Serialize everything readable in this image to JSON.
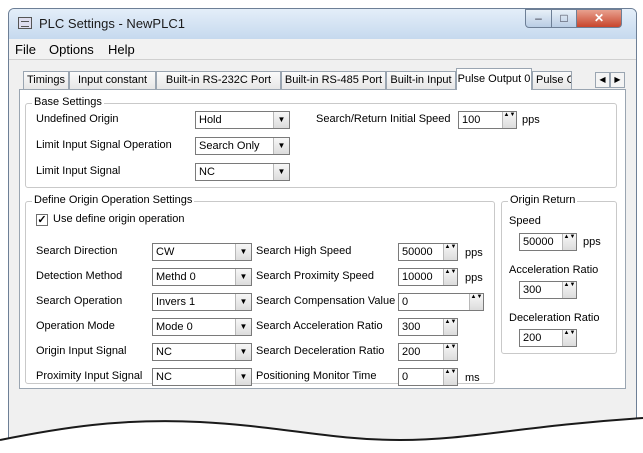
{
  "window": {
    "title": "PLC Settings - NewPLC1",
    "min": "–",
    "max": "□",
    "close": "✕"
  },
  "menu": [
    "File",
    "Options",
    "Help"
  ],
  "tabs": [
    "Timings",
    "Input constant",
    "Built-in RS-232C Port",
    "Built-in RS-485 Port",
    "Built-in Input",
    "Pulse Output 0",
    "Pulse O"
  ],
  "tab_nav": {
    "prev": "◀",
    "next": "▶"
  },
  "base": {
    "title": "Base Settings",
    "undefined_origin": {
      "label": "Undefined Origin",
      "value": "Hold"
    },
    "limit_op": {
      "label": "Limit Input Signal Operation",
      "value": "Search Only"
    },
    "limit_sig": {
      "label": "Limit Input Signal",
      "value": "NC"
    },
    "init_speed": {
      "label": "Search/Return Initial Speed",
      "value": "100",
      "unit": "pps"
    }
  },
  "define": {
    "title": "Define Origin Operation Settings",
    "use_label": "Use define origin operation",
    "check": "✓",
    "search_direction": {
      "label": "Search Direction",
      "value": "CW"
    },
    "detection_method": {
      "label": "Detection Method",
      "value": "Methd 0"
    },
    "search_operation": {
      "label": "Search Operation",
      "value": "Invers 1"
    },
    "operation_mode": {
      "label": "Operation Mode",
      "value": "Mode 0"
    },
    "origin_signal": {
      "label": "Origin Input Signal",
      "value": "NC"
    },
    "proximity_signal": {
      "label": "Proximity Input Signal",
      "value": "NC"
    },
    "high_speed": {
      "label": "Search High Speed",
      "value": "50000",
      "unit": "pps"
    },
    "proximity_speed": {
      "label": "Search Proximity Speed",
      "value": "10000",
      "unit": "pps"
    },
    "compensation": {
      "label": "Search Compensation Value",
      "value": "0"
    },
    "accel_ratio": {
      "label": "Search Acceleration Ratio",
      "value": "300"
    },
    "decel_ratio": {
      "label": "Search Deceleration Ratio",
      "value": "200"
    },
    "monitor_time": {
      "label": "Positioning Monitor Time",
      "value": "0",
      "unit": "ms"
    }
  },
  "origin_return": {
    "title": "Origin Return",
    "speed": {
      "label": "Speed",
      "value": "50000",
      "unit": "pps"
    },
    "accel": {
      "label": "Acceleration Ratio",
      "value": "300"
    },
    "decel": {
      "label": "Deceleration Ratio",
      "value": "200"
    }
  },
  "glyphs": {
    "dropdown": "▼",
    "spin": "▲▼"
  },
  "colors": {
    "title_bar": "#c6d9ee",
    "close_button": "#c8452c",
    "panel": "#ffffff"
  }
}
